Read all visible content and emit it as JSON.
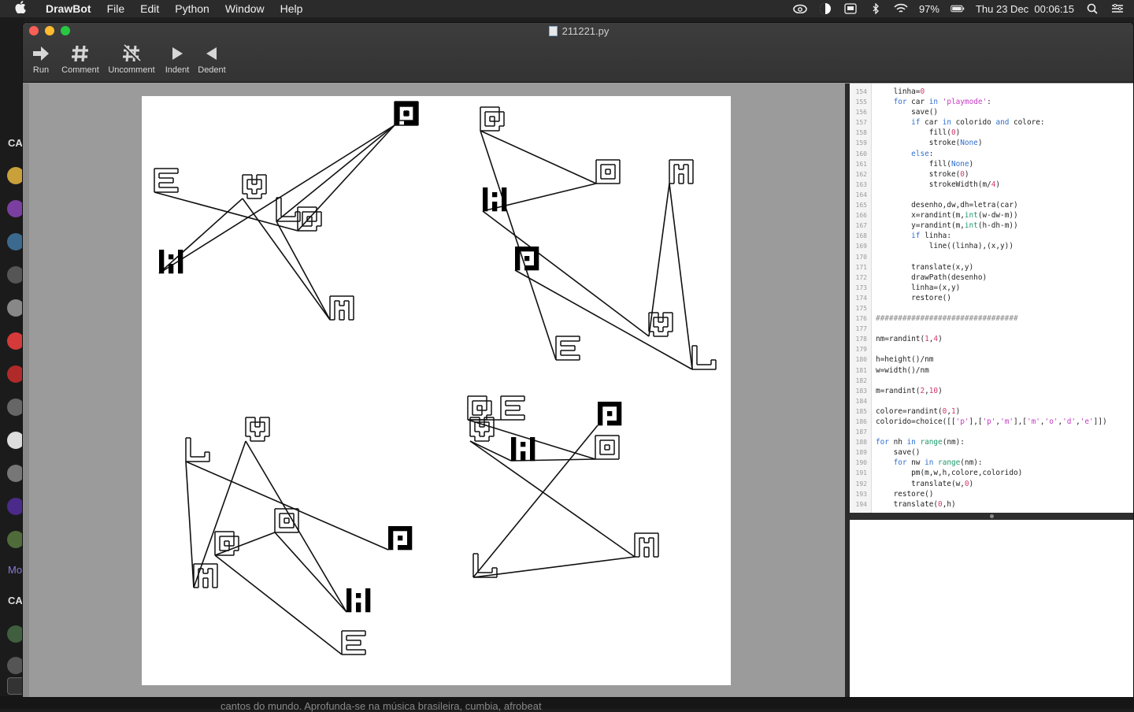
{
  "menubar": {
    "app_name": "DrawBot",
    "items": [
      "File",
      "Edit",
      "Python",
      "Window",
      "Help"
    ],
    "battery": "97%",
    "clock": "Thu 23 Dec  00:06:15"
  },
  "background": {
    "sidebar_labels": [
      "CA",
      "Mo",
      "CA"
    ],
    "bottom_text": "cantos do mundo. Aprofunda-se na música brasileira, cumbia, afrobeat"
  },
  "window": {
    "title": "211221.py",
    "toolbar": [
      {
        "label": "Run",
        "icon": "run-arrow-icon"
      },
      {
        "label": "Comment",
        "icon": "hash-icon"
      },
      {
        "label": "Uncomment",
        "icon": "crossed-hash-icon"
      },
      {
        "label": "Indent",
        "icon": "play-right-icon"
      },
      {
        "label": "Dedent",
        "icon": "play-left-icon"
      }
    ]
  },
  "editor": {
    "lines": [
      {
        "n": "154",
        "code": "    linha=0"
      },
      {
        "n": "155",
        "code": "    for car in 'playmode':"
      },
      {
        "n": "156",
        "code": "        save()"
      },
      {
        "n": "157",
        "code": "        if car in colorido and colore:"
      },
      {
        "n": "158",
        "code": "            fill(0)"
      },
      {
        "n": "159",
        "code": "            stroke(None)"
      },
      {
        "n": "160",
        "code": "        else:"
      },
      {
        "n": "161",
        "code": "            fill(None)"
      },
      {
        "n": "162",
        "code": "            stroke(0)"
      },
      {
        "n": "163",
        "code": "            strokeWidth(m/4)"
      },
      {
        "n": "164",
        "code": ""
      },
      {
        "n": "165",
        "code": "        desenho,dw,dh=letra(car)"
      },
      {
        "n": "166",
        "code": "        x=randint(m,int(w-dw-m))"
      },
      {
        "n": "167",
        "code": "        y=randint(m,int(h-dh-m))"
      },
      {
        "n": "168",
        "code": "        if linha:"
      },
      {
        "n": "169",
        "code": "            line((linha),(x,y))"
      },
      {
        "n": "170",
        "code": ""
      },
      {
        "n": "171",
        "code": "        translate(x,y)"
      },
      {
        "n": "172",
        "code": "        drawPath(desenho)"
      },
      {
        "n": "173",
        "code": "        linha=(x,y)"
      },
      {
        "n": "174",
        "code": "        restore()"
      },
      {
        "n": "175",
        "code": ""
      },
      {
        "n": "176",
        "code": "################################"
      },
      {
        "n": "177",
        "code": ""
      },
      {
        "n": "178",
        "code": "nm=randint(1,4)"
      },
      {
        "n": "179",
        "code": ""
      },
      {
        "n": "180",
        "code": "h=height()/nm"
      },
      {
        "n": "181",
        "code": "w=width()/nm"
      },
      {
        "n": "182",
        "code": ""
      },
      {
        "n": "183",
        "code": "m=randint(2,10)"
      },
      {
        "n": "184",
        "code": ""
      },
      {
        "n": "185",
        "code": "colore=randint(0,1)"
      },
      {
        "n": "186",
        "code": "colorido=choice([['p'],['p','m'],['m','o','d','e']])"
      },
      {
        "n": "187",
        "code": ""
      },
      {
        "n": "188",
        "code": "for nh in range(nm):"
      },
      {
        "n": "189",
        "code": "    save()"
      },
      {
        "n": "190",
        "code": "    for nw in range(nm):"
      },
      {
        "n": "191",
        "code": "        pm(m,w,h,colore,colorido)"
      },
      {
        "n": "192",
        "code": "        translate(w,0)"
      },
      {
        "n": "193",
        "code": "    restore()"
      },
      {
        "n": "194",
        "code": "    translate(0,h)"
      }
    ]
  },
  "artwork": {
    "word": "playmode",
    "cells": [
      {
        "glyphs": [
          [
            "p",
            515,
            143,
            true
          ],
          [
            "l",
            365,
            265,
            false
          ],
          [
            "a",
            433,
            390,
            false
          ],
          [
            "y",
            322,
            236,
            false
          ],
          [
            "m",
            216,
            331,
            true
          ],
          [
            "o",
            515,
            143,
            false
          ],
          [
            "d",
            392,
            277,
            false
          ],
          [
            "e",
            210,
            228,
            false
          ]
        ]
      },
      {
        "glyphs": [
          [
            "p",
            668,
            327,
            true
          ],
          [
            "l",
            893,
            453,
            false
          ],
          [
            "a",
            864,
            217,
            false
          ],
          [
            "y",
            838,
            411,
            false
          ],
          [
            "m",
            627,
            252,
            true
          ],
          [
            "o",
            771,
            217,
            false
          ],
          [
            "d",
            624,
            150,
            false
          ],
          [
            "e",
            720,
            441,
            false
          ]
        ]
      },
      {
        "glyphs": [
          [
            "p",
            507,
            682,
            true
          ],
          [
            "l",
            250,
            570,
            false
          ],
          [
            "a",
            260,
            730,
            false
          ],
          [
            "y",
            326,
            544,
            false
          ],
          [
            "m",
            454,
            761,
            true
          ],
          [
            "o",
            363,
            660,
            false
          ],
          [
            "d",
            287,
            689,
            false
          ],
          [
            "e",
            448,
            815,
            false
          ]
        ]
      },
      {
        "glyphs": [
          [
            "p",
            773,
            524,
            true
          ],
          [
            "l",
            615,
            717,
            false
          ],
          [
            "a",
            820,
            691,
            false
          ],
          [
            "y",
            611,
            544,
            false
          ],
          [
            "m",
            663,
            569,
            true
          ],
          [
            "o",
            770,
            567,
            false
          ],
          [
            "d",
            608,
            517,
            false
          ],
          [
            "e",
            650,
            517,
            false
          ]
        ]
      }
    ]
  }
}
